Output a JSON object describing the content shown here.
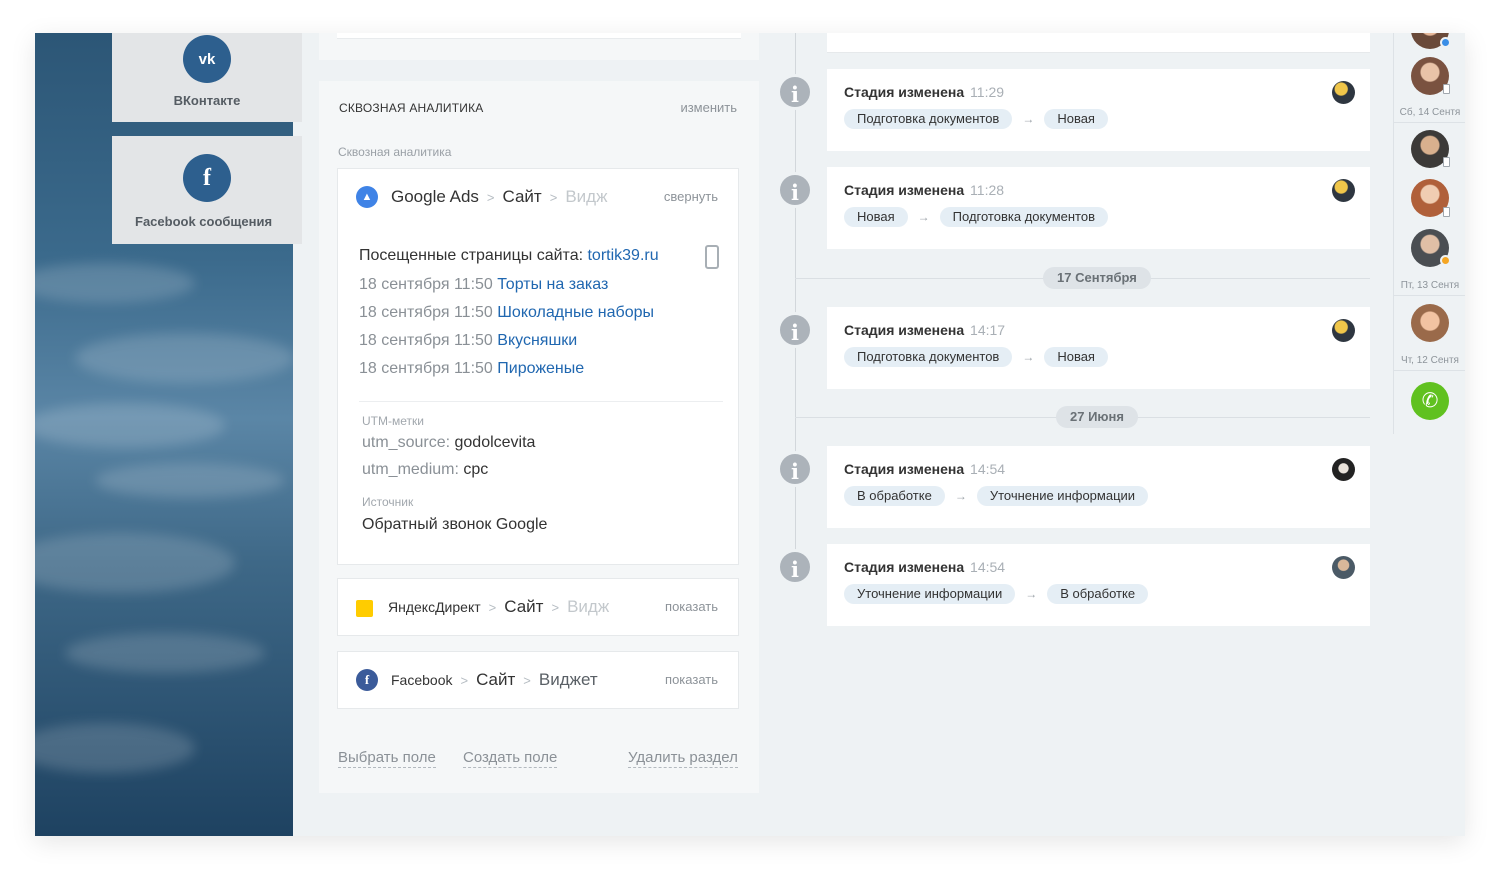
{
  "social": [
    {
      "name": "ВКонтакте",
      "glyph": "vk"
    },
    {
      "name": "Facebook сообщения",
      "glyph": "f"
    }
  ],
  "analytics": {
    "title": "СКВОЗНАЯ АНАЛИТИКА",
    "edit_label": "изменить",
    "subtitle": "Сквозная аналитика",
    "google": {
      "source": "Google Ads",
      "path1": "Сайт",
      "path2": "Видж",
      "toggle": "свернуть",
      "visited_label": "Посещенные страницы сайта:",
      "site": "tortik39.ru",
      "visits": [
        {
          "date": "18 сентября 11:50",
          "page": "Торты на заказ"
        },
        {
          "date": "18 сентября 11:50",
          "page": "Шоколадные наборы"
        },
        {
          "date": "18 сентября 11:50",
          "page": "Вкусняшки"
        },
        {
          "date": "18 сентября 11:50",
          "page": "Пироженые"
        }
      ],
      "utm_label": "UTM-метки",
      "utm_source_key": "utm_source:",
      "utm_source_val": "godolcevita",
      "utm_medium_key": "utm_medium:",
      "utm_medium_val": "cpc",
      "source_label": "Источник",
      "source_val": "Обратный звонок Google"
    },
    "yandex": {
      "source": "ЯндексДирект",
      "path1": "Сайт",
      "path2": "Видж",
      "toggle": "показать"
    },
    "facebook": {
      "source": "Facebook",
      "path1": "Сайт",
      "path2": "Виджет",
      "toggle": "показать"
    },
    "footer": {
      "select_field": "Выбрать поле",
      "create_field": "Создать поле",
      "delete_section": "Удалить раздел"
    }
  },
  "timeline": [
    {
      "title": "Стадия изменена",
      "time": "11:29",
      "from": "Подготовка документов",
      "to": "Новая"
    },
    {
      "title": "Стадия изменена",
      "time": "11:28",
      "from": "Новая",
      "to": "Подготовка документов"
    },
    {
      "title": "Стадия изменена",
      "time": "14:17",
      "from": "Подготовка документов",
      "to": "Новая"
    },
    {
      "title": "Стадия изменена",
      "time": "14:54",
      "from": "В обработке",
      "to": "Уточнение информации"
    },
    {
      "title": "Стадия изменена",
      "time": "14:54",
      "from": "Уточнение информации",
      "to": "В обработке"
    }
  ],
  "date_separators": [
    "17 Сентября",
    "27 Июня"
  ],
  "strip_dates": [
    "Сб, 14 Сентя",
    "Пт, 13 Сентя",
    "Чт, 12 Сентя"
  ],
  "colors": {
    "accent_blue": "#2067b0",
    "vk": "#2d5f8e",
    "call_green": "#60c11f",
    "pill_bg": "#e5eef5"
  },
  "icons": [
    "vk-icon",
    "facebook-icon",
    "google-ads-icon",
    "yandex-direct-icon",
    "info-icon",
    "phone-device-icon",
    "call-icon"
  ]
}
